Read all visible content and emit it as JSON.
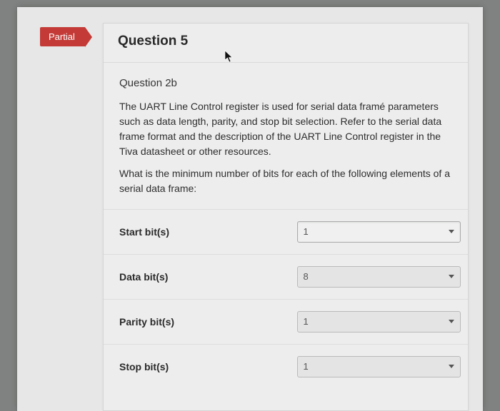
{
  "badge": {
    "label": "Partial"
  },
  "header": {
    "title": "Question 5"
  },
  "body": {
    "subtitle": "Question 2b",
    "para1": "The UART Line Control register is used for serial data framé parameters such as data length, parity, and stop bit selection. Refer to the serial data frame format and the description of the UART Line Control register in the Tiva datasheet or other resources.",
    "para2": "What is the minimum number of bits for each of the following elements of a serial data frame:"
  },
  "rows": [
    {
      "label": "Start bit(s)",
      "value": "1",
      "highlight": true
    },
    {
      "label": "Data bit(s)",
      "value": "8",
      "highlight": false
    },
    {
      "label": "Parity bit(s)",
      "value": "1",
      "highlight": false
    },
    {
      "label": "Stop bit(s)",
      "value": "1",
      "highlight": false
    }
  ]
}
